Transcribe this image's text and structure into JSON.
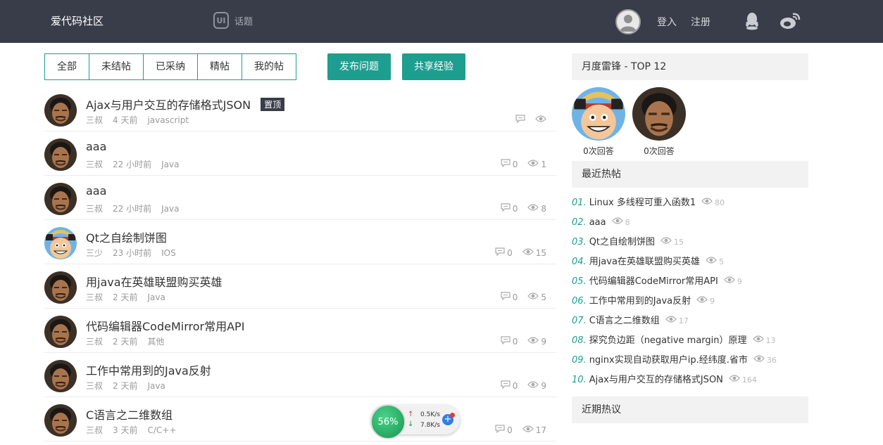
{
  "header": {
    "logo": "爱代码社区",
    "topic_badge": "UI",
    "topic_label": "话题",
    "login": "登入",
    "register": "注册"
  },
  "tabs": [
    "全部",
    "未结帖",
    "已采纳",
    "精帖",
    "我的帖"
  ],
  "buttons": {
    "ask": "发布问题",
    "share": "共享经验"
  },
  "posts": [
    {
      "title": "Ajax与用户交互的存储格式JSON",
      "pinned": "置顶",
      "author": "三叔",
      "time": "4 天前",
      "category": "javascript",
      "comments": "",
      "views": "",
      "avatar": "man"
    },
    {
      "title": "aaa",
      "author": "三叔",
      "time": "22 小时前",
      "category": "Java",
      "comments": "0",
      "views": "1",
      "avatar": "man"
    },
    {
      "title": "aaa",
      "author": "三叔",
      "time": "22 小时前",
      "category": "Java",
      "comments": "0",
      "views": "8",
      "avatar": "man"
    },
    {
      "title": "Qt之自绘制饼图",
      "author": "三少",
      "time": "23 小时前",
      "category": "IOS",
      "comments": "0",
      "views": "15",
      "avatar": "luffy"
    },
    {
      "title": "用java在英雄联盟购买英雄",
      "author": "三叔",
      "time": "2 天前",
      "category": "Java",
      "comments": "0",
      "views": "5",
      "avatar": "man"
    },
    {
      "title": "代码编辑器CodeMirror常用API",
      "author": "三叔",
      "time": "2 天前",
      "category": "其他",
      "comments": "0",
      "views": "9",
      "avatar": "man"
    },
    {
      "title": "工作中常用到的Java反射",
      "author": "三叔",
      "time": "2 天前",
      "category": "Java",
      "comments": "0",
      "views": "9",
      "avatar": "man"
    },
    {
      "title": "C语言之二维数组",
      "author": "三叔",
      "time": "3 天前",
      "category": "C/C++",
      "comments": "0",
      "views": "17",
      "avatar": "man"
    }
  ],
  "sidebar": {
    "top_title": "月度雷锋 - TOP 12",
    "top_users": [
      {
        "answers": "0次回答",
        "avatar": "luffy"
      },
      {
        "answers": "0次回答",
        "avatar": "man"
      }
    ],
    "hot_title": "最近热帖",
    "hot": [
      {
        "num": "01.",
        "title": "Linux 多线程可重入函数1",
        "views": "80"
      },
      {
        "num": "02.",
        "title": "aaa",
        "views": "8"
      },
      {
        "num": "03.",
        "title": "Qt之自绘制饼图",
        "views": "15"
      },
      {
        "num": "04.",
        "title": "用java在英雄联盟购买英雄",
        "views": "5"
      },
      {
        "num": "05.",
        "title": "代码编辑器CodeMirror常用API",
        "views": "9"
      },
      {
        "num": "06.",
        "title": "工作中常用到的Java反射",
        "views": "9"
      },
      {
        "num": "07.",
        "title": "C语言之二维数组",
        "views": "17"
      },
      {
        "num": "08.",
        "title": "探究负边距（negative margin）原理",
        "views": "13"
      },
      {
        "num": "09.",
        "title": "nginx实现自动获取用户ip.经纬度.省市",
        "views": "36"
      },
      {
        "num": "10.",
        "title": "Ajax与用户交互的存储格式JSON",
        "views": "164"
      }
    ],
    "recent_title": "近期热议"
  },
  "speed_widget": {
    "percent": "56%",
    "up": "0.5K/s",
    "down": "7.8K/s"
  },
  "colors": {
    "header_bg": "#393d49",
    "accent": "#1e9e8f"
  }
}
